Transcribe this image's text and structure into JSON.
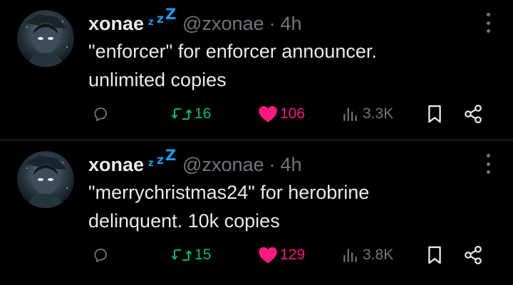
{
  "colors": {
    "background": "#000000",
    "text": "#e7e9ea",
    "muted": "#71767b",
    "repost": "#00ba7c",
    "like": "#f91880",
    "badge": "#1d9bf0",
    "divider": "#2f3336"
  },
  "posts": [
    {
      "author": {
        "name": "xonae",
        "badge_icon": "zzz-sleep-icon",
        "badge_letters": [
          "z",
          "z",
          "Z"
        ],
        "handle": "@zxonae",
        "separator": "·",
        "time": "4h"
      },
      "text_lines": [
        "\"enforcer\" for enforcer announcer.",
        "unlimited copies"
      ],
      "actions": {
        "reply_icon": "reply-bubble-icon",
        "repost_icon": "repost-icon",
        "repost_count": "16",
        "like_icon": "heart-filled-icon",
        "like_count": "106",
        "views_icon": "views-bar-chart-icon",
        "views_count": "3.3K",
        "bookmark_icon": "bookmark-icon",
        "share_icon": "share-icon"
      },
      "more_icon": "vertical-ellipsis-icon"
    },
    {
      "author": {
        "name": "xonae",
        "badge_icon": "zzz-sleep-icon",
        "badge_letters": [
          "z",
          "z",
          "Z"
        ],
        "handle": "@zxonae",
        "separator": "·",
        "time": "4h"
      },
      "text_lines": [
        "\"merrychristmas24\" for herobrine",
        "delinquent. 10k copies"
      ],
      "actions": {
        "reply_icon": "reply-bubble-icon",
        "repost_icon": "repost-icon",
        "repost_count": "15",
        "like_icon": "heart-filled-icon",
        "like_count": "129",
        "views_icon": "views-bar-chart-icon",
        "views_count": "3.8K",
        "bookmark_icon": "bookmark-icon",
        "share_icon": "share-icon"
      },
      "more_icon": "vertical-ellipsis-icon"
    }
  ]
}
